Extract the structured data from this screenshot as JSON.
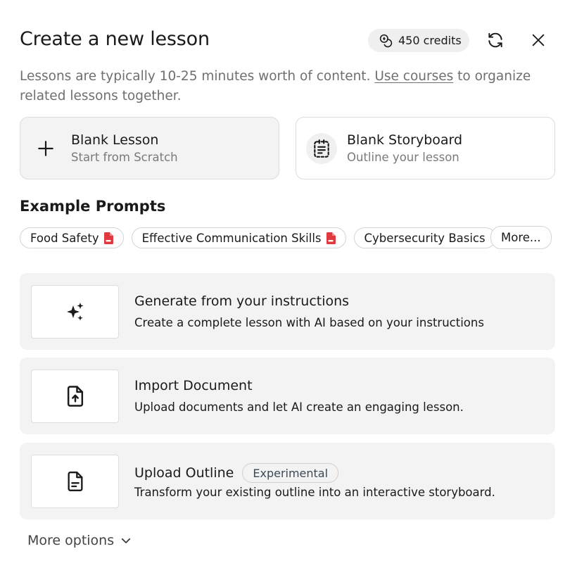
{
  "dialog": {
    "title": "Create a new lesson",
    "credits": "450 credits",
    "subtitle_before": "Lessons are typically 10-25 minutes worth of content. ",
    "subtitle_link": "Use courses",
    "subtitle_after": " to organize related lessons together."
  },
  "cards": {
    "blank_lesson": {
      "title": "Blank Lesson",
      "sub": "Start from Scratch"
    },
    "blank_storyboard": {
      "title": "Blank Storyboard",
      "sub": "Outline your lesson"
    }
  },
  "prompts": {
    "title": "Example Prompts",
    "chips": [
      "Food Safety",
      "Effective Communication Skills",
      "Cybersecurity Basics"
    ],
    "more": "More..."
  },
  "options": {
    "generate": {
      "title": "Generate from your instructions",
      "desc": "Create a complete lesson with AI based on your instructions"
    },
    "import": {
      "title": "Import Document",
      "desc": "Upload documents and let AI create an engaging lesson."
    },
    "outline": {
      "title": "Upload Outline",
      "badge": "Experimental",
      "desc": "Transform your existing outline into an interactive storyboard."
    }
  },
  "footer": {
    "more_options": "More options"
  },
  "colors": {
    "card_bg": "#f3f3f3",
    "pdf_red": "#e0393e",
    "muted_text": "#6f6f6f"
  },
  "icons": [
    "credits-icon",
    "refresh-icon",
    "close-icon",
    "plus-icon",
    "storyboard-icon",
    "pdf-icon",
    "sparkles-icon",
    "file-upload-icon",
    "document-icon",
    "chevron-down-icon"
  ]
}
